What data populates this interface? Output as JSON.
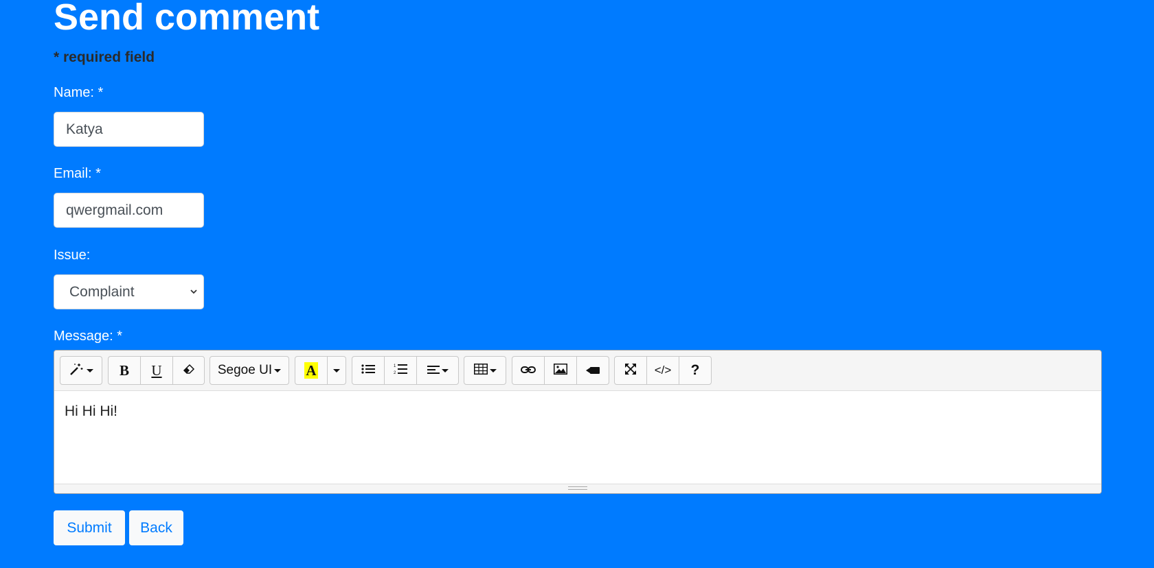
{
  "page": {
    "title": "Send comment",
    "required_note": "* required field"
  },
  "form": {
    "name": {
      "label": "Name: *",
      "value": "Katya"
    },
    "email": {
      "label": "Email: *",
      "value": "qwergmail.com"
    },
    "issue": {
      "label": "Issue:",
      "selected": "Complaint"
    },
    "message": {
      "label": "Message: *",
      "content": "Hi Hi Hi!"
    }
  },
  "toolbar": {
    "style_icon": "magic-wand-icon",
    "bold_label": "B",
    "underline_label": "U",
    "eraser_icon": "eraser-icon",
    "font_name": "Segoe UI",
    "color_label": "A",
    "highlight_color": "#ffff00",
    "unordered_list_icon": "unordered-list-icon",
    "ordered_list_icon": "ordered-list-icon",
    "align_icon": "align-left-icon",
    "table_icon": "table-icon",
    "link_icon": "link-icon",
    "picture_icon": "picture-icon",
    "video_icon": "video-icon",
    "fullscreen_icon": "fullscreen-icon",
    "codeview_label": "</>",
    "help_label": "?"
  },
  "actions": {
    "submit_label": "Submit",
    "back_label": "Back"
  },
  "colors": {
    "background": "#007bff",
    "button_text": "#007bff",
    "button_bg": "#f8f9fa"
  }
}
